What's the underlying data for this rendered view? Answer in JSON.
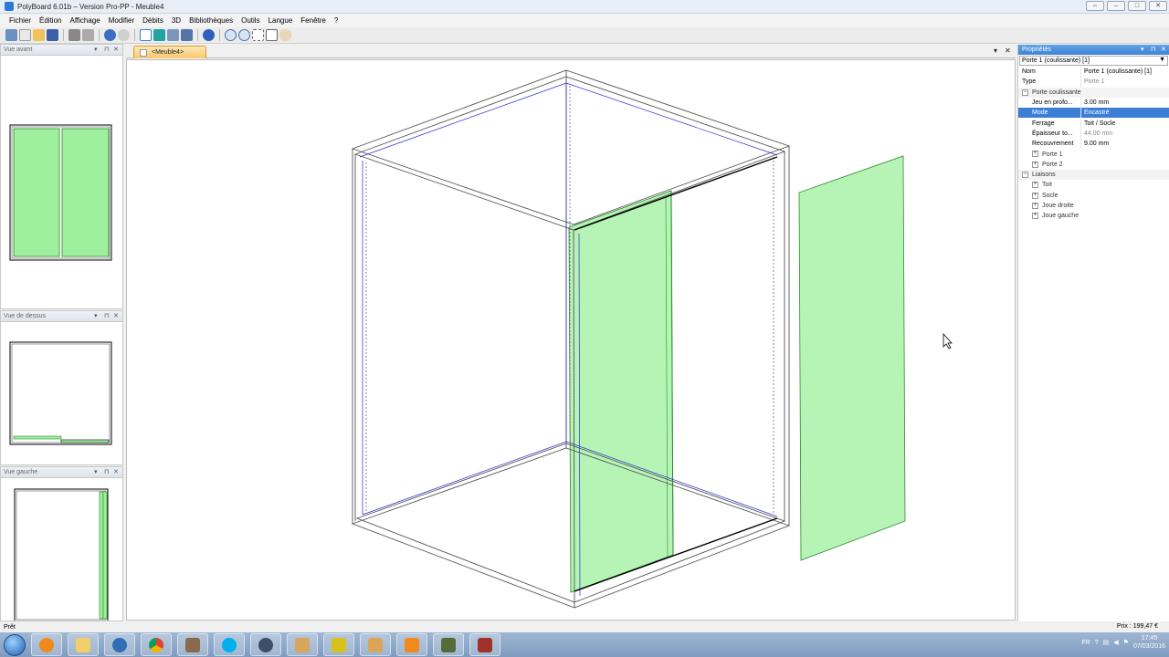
{
  "window": {
    "title": "PolyBoard 6.01b – Version Pro-PP - Meuble4"
  },
  "menu": [
    "Fichier",
    "Édition",
    "Affichage",
    "Modifier",
    "Débits",
    "3D",
    "Bibliothèques",
    "Outils",
    "Langue",
    "Fenêtre",
    "?"
  ],
  "views": {
    "front": {
      "title": "Vue avant"
    },
    "top": {
      "title": "Vue de dessus"
    },
    "left": {
      "title": "Vue gauche"
    }
  },
  "document_tab": {
    "label": "<Meuble4>"
  },
  "properties": {
    "title": "Propriétés",
    "selected_object": "Porte 1 (coulissante) [1]",
    "rows": {
      "nom": {
        "label": "Nom",
        "value": "Porte 1 (coulissante) [1]"
      },
      "type": {
        "label": "Type",
        "value": "Porte 1"
      },
      "cat_porte": {
        "label": "Porte coulissante"
      },
      "jeu": {
        "label": "Jeu en profo...",
        "value": "3.00 mm"
      },
      "mode": {
        "label": "Mode",
        "value": "Encastré"
      },
      "ferrage": {
        "label": "Ferrage",
        "value": "Toit / Socle"
      },
      "epaisseur": {
        "label": "Épaisseur to...",
        "value": "44.00 mm"
      },
      "recouvrement": {
        "label": "Recouvrement",
        "value": "9.00 mm"
      },
      "porte1": {
        "label": "Porte 1"
      },
      "porte2": {
        "label": "Porte 2"
      },
      "cat_liaisons": {
        "label": "Liaisons"
      },
      "toit": {
        "label": "Toit"
      },
      "socle": {
        "label": "Socle"
      },
      "joue_droite": {
        "label": "Joue droite"
      },
      "joue_gauche": {
        "label": "Joue gauche"
      }
    }
  },
  "status": {
    "left": "Prêt",
    "price": "Prix : 199,47 €"
  },
  "tray": {
    "lang": "FR",
    "time": "17:45",
    "date": "07/03/2016"
  },
  "colors": {
    "door_green": "#9ef09e",
    "accent_blue": "#3a7fd5",
    "tab_orange": "#f9c96c"
  }
}
